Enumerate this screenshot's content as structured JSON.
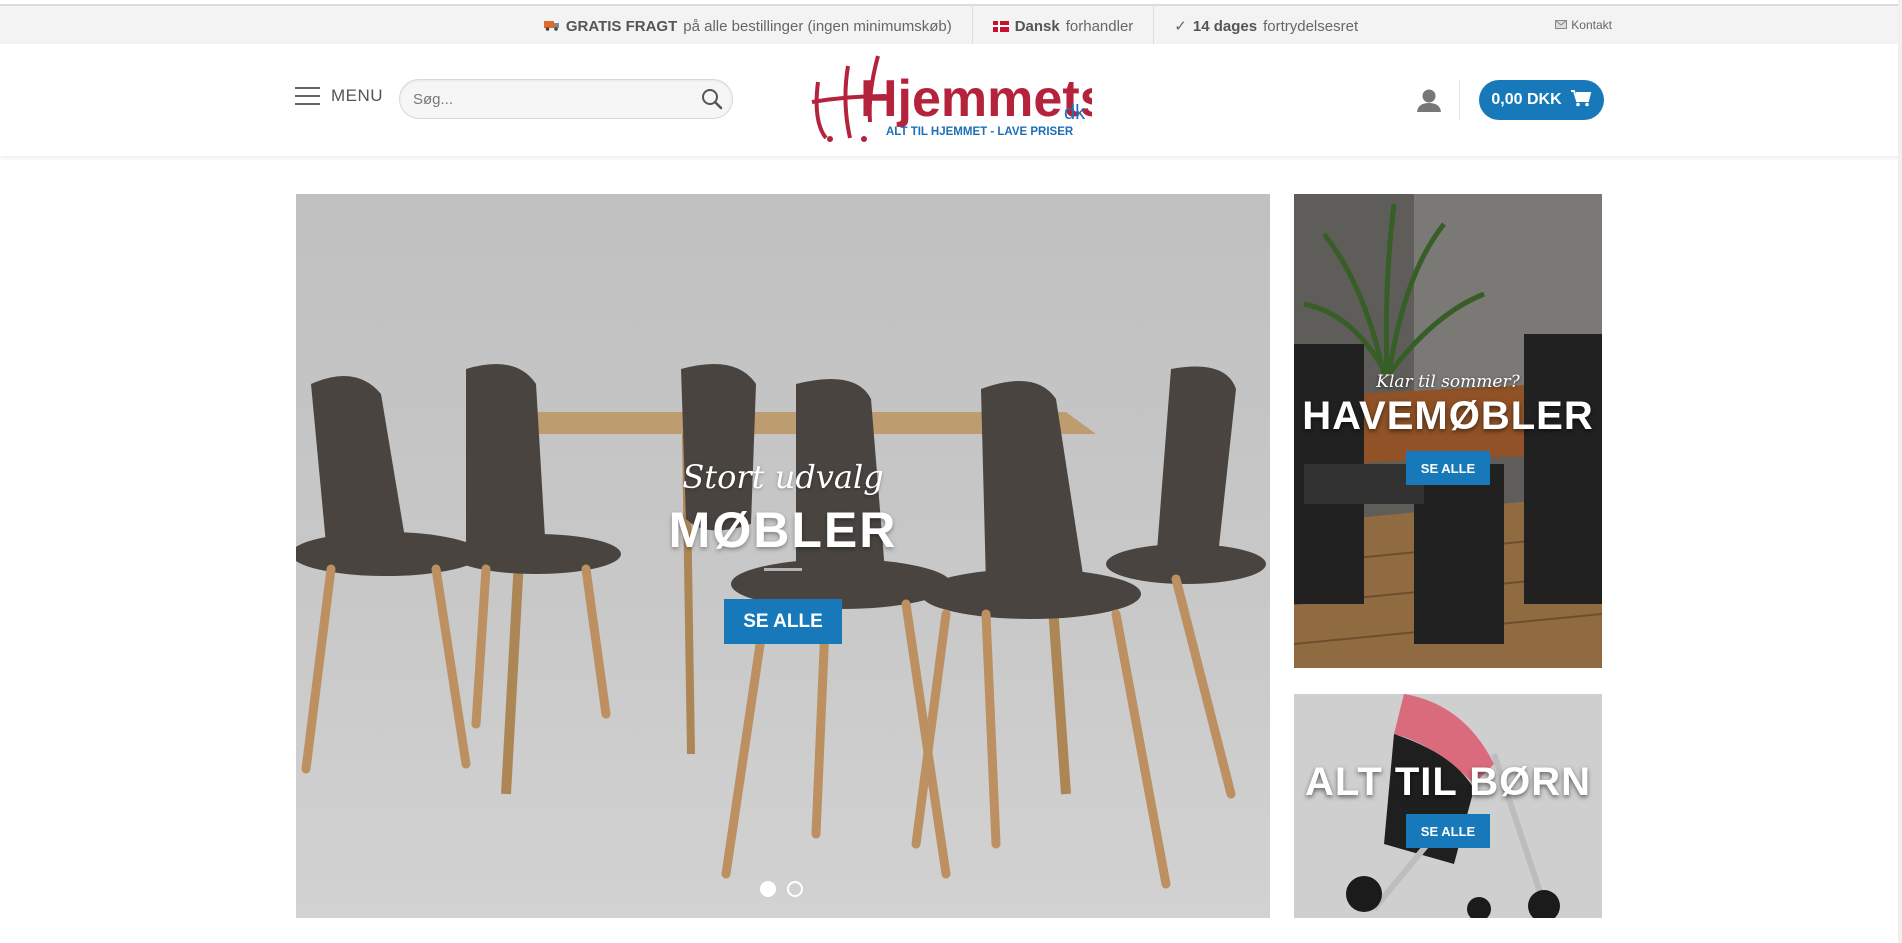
{
  "topbar": {
    "items": [
      {
        "icon": "truck-icon",
        "bold": "GRATIS FRAGT",
        "text": "på alle bestillinger (ingen minimumskøb)"
      },
      {
        "icon": "danish-flag-icon",
        "bold": "Dansk",
        "text": "forhandler"
      },
      {
        "icon": "check-icon",
        "bold": "14 dages",
        "text": "fortrydelsesret"
      }
    ],
    "contact_label": "Kontakt"
  },
  "header": {
    "menu_label": "MENU",
    "search_placeholder": "Søg...",
    "logo_text": "Hjemmets",
    "logo_suffix": "dk",
    "logo_tagline": "ALT TIL HJEMMET - LAVE PRISER",
    "cart_total": "0,00 DKK"
  },
  "hero": {
    "tagline": "Stort udvalg",
    "title": "MØBLER",
    "button": "SE ALLE",
    "slides": 2,
    "active_slide": 1
  },
  "side_banners": [
    {
      "subtitle": "Klar til sommer?",
      "title": "HAVEMØBLER",
      "button": "SE ALLE"
    },
    {
      "title": "ALT TIL BØRN",
      "button": "SE ALLE"
    }
  ],
  "colors": {
    "accent": "#1779ba",
    "logo_red": "#b5223c",
    "logo_blue": "#1d6fb8"
  }
}
